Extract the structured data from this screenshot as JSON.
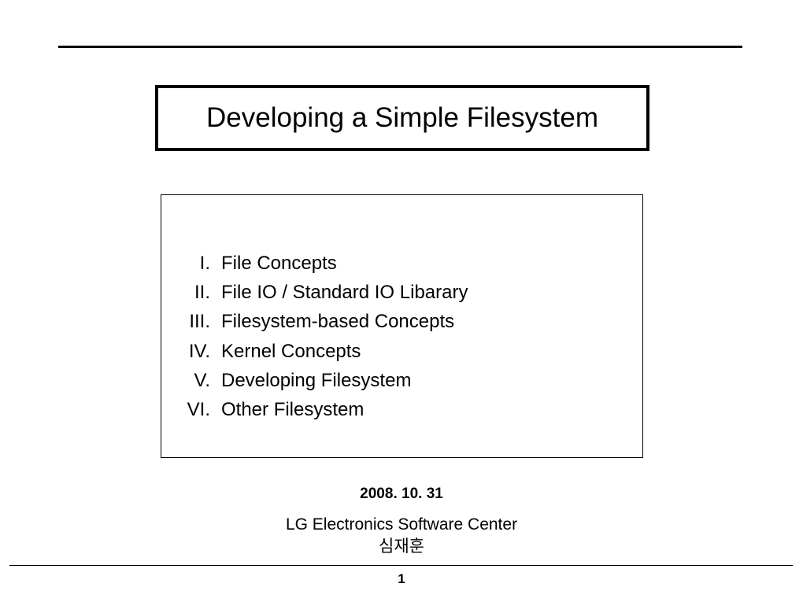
{
  "title": "Developing a Simple Filesystem",
  "toc": [
    {
      "num": "I.",
      "label": "File Concepts"
    },
    {
      "num": "II.",
      "label": "File IO / Standard IO Libarary"
    },
    {
      "num": "III.",
      "label": "Filesystem-based Concepts"
    },
    {
      "num": "IV.",
      "label": "Kernel Concepts"
    },
    {
      "num": "V.",
      "label": "Developing Filesystem"
    },
    {
      "num": "VI.",
      "label": "Other Filesystem"
    }
  ],
  "date": "2008. 10. 31",
  "organization": "LG Electronics Software Center",
  "author": "심재훈",
  "page_number": "1"
}
